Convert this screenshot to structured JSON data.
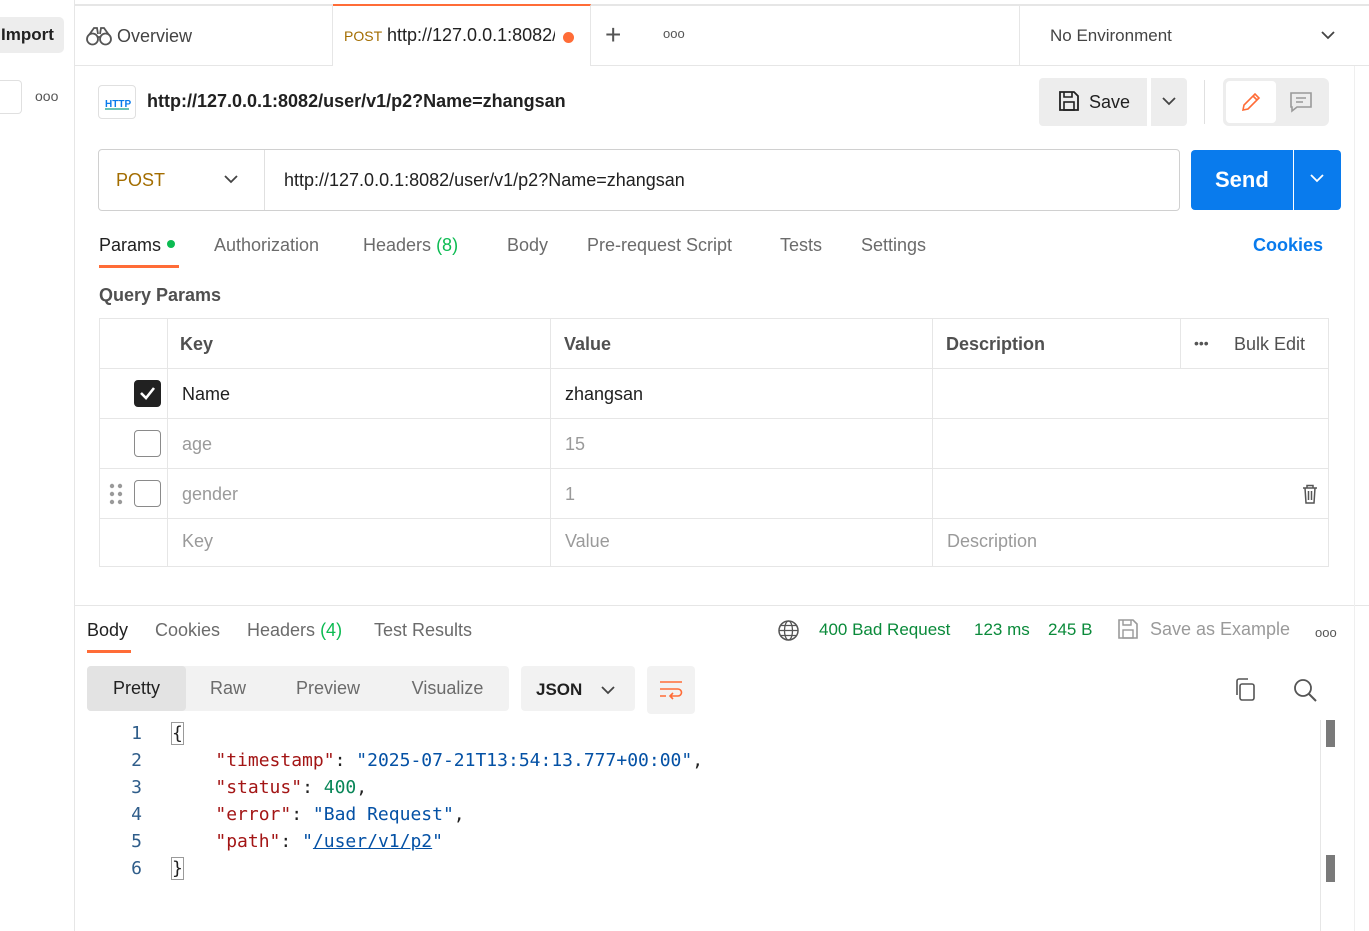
{
  "sidebar": {
    "import_label": "Import",
    "more_label": "ooo"
  },
  "tabs": {
    "overview_label": "Overview",
    "active_method": "POST",
    "active_url": "http://127.0.0.1:8082/user/v1/p2?Name=zhangsan",
    "plus_label": "+",
    "more_label": "ooo"
  },
  "environment": {
    "label": "No Environment"
  },
  "request": {
    "icon_label": "HTTP",
    "title": "http://127.0.0.1:8082/user/v1/p2?Name=zhangsan",
    "save_label": "Save",
    "method": "POST",
    "url": "http://127.0.0.1:8082/user/v1/p2?Name=zhangsan",
    "send_label": "Send"
  },
  "request_tabs": {
    "params": "Params",
    "authorization": "Authorization",
    "headers": "Headers",
    "headers_count": "(8)",
    "body": "Body",
    "prerequest": "Pre-request Script",
    "tests": "Tests",
    "settings": "Settings",
    "cookies": "Cookies"
  },
  "query_params": {
    "title": "Query Params",
    "headers": {
      "key": "Key",
      "value": "Value",
      "description": "Description",
      "more": "•••",
      "bulk_edit": "Bulk Edit"
    },
    "rows": [
      {
        "checked": true,
        "key": "Name",
        "value": "zhangsan",
        "description": ""
      },
      {
        "checked": false,
        "key": "age",
        "value": "15",
        "description": ""
      },
      {
        "checked": false,
        "key": "gender",
        "value": "1",
        "description": ""
      }
    ],
    "placeholder": {
      "key": "Key",
      "value": "Value",
      "description": "Description"
    }
  },
  "response": {
    "tabs": {
      "body": "Body",
      "cookies": "Cookies",
      "headers": "Headers",
      "headers_count": "(4)",
      "test_results": "Test Results"
    },
    "status": "400 Bad Request",
    "time": "123 ms",
    "size": "245 B",
    "save_example": "Save as Example",
    "more_label": "ooo",
    "formats": [
      "Pretty",
      "Raw",
      "Preview",
      "Visualize"
    ],
    "language": "JSON",
    "line_numbers": [
      "1",
      "2",
      "3",
      "4",
      "5",
      "6"
    ],
    "json": {
      "timestamp_key": "\"timestamp\"",
      "timestamp_val": "\"2025-07-21T13:54:13.777+00:00\"",
      "status_key": "\"status\"",
      "status_val": "400",
      "error_key": "\"error\"",
      "error_val": "\"Bad Request\"",
      "path_key": "\"path\"",
      "path_val": "/user/v1/p2"
    }
  },
  "colors": {
    "accent": "#ff6c37",
    "send": "#097bed",
    "success": "#0cbb52",
    "method": "#a36d00"
  }
}
